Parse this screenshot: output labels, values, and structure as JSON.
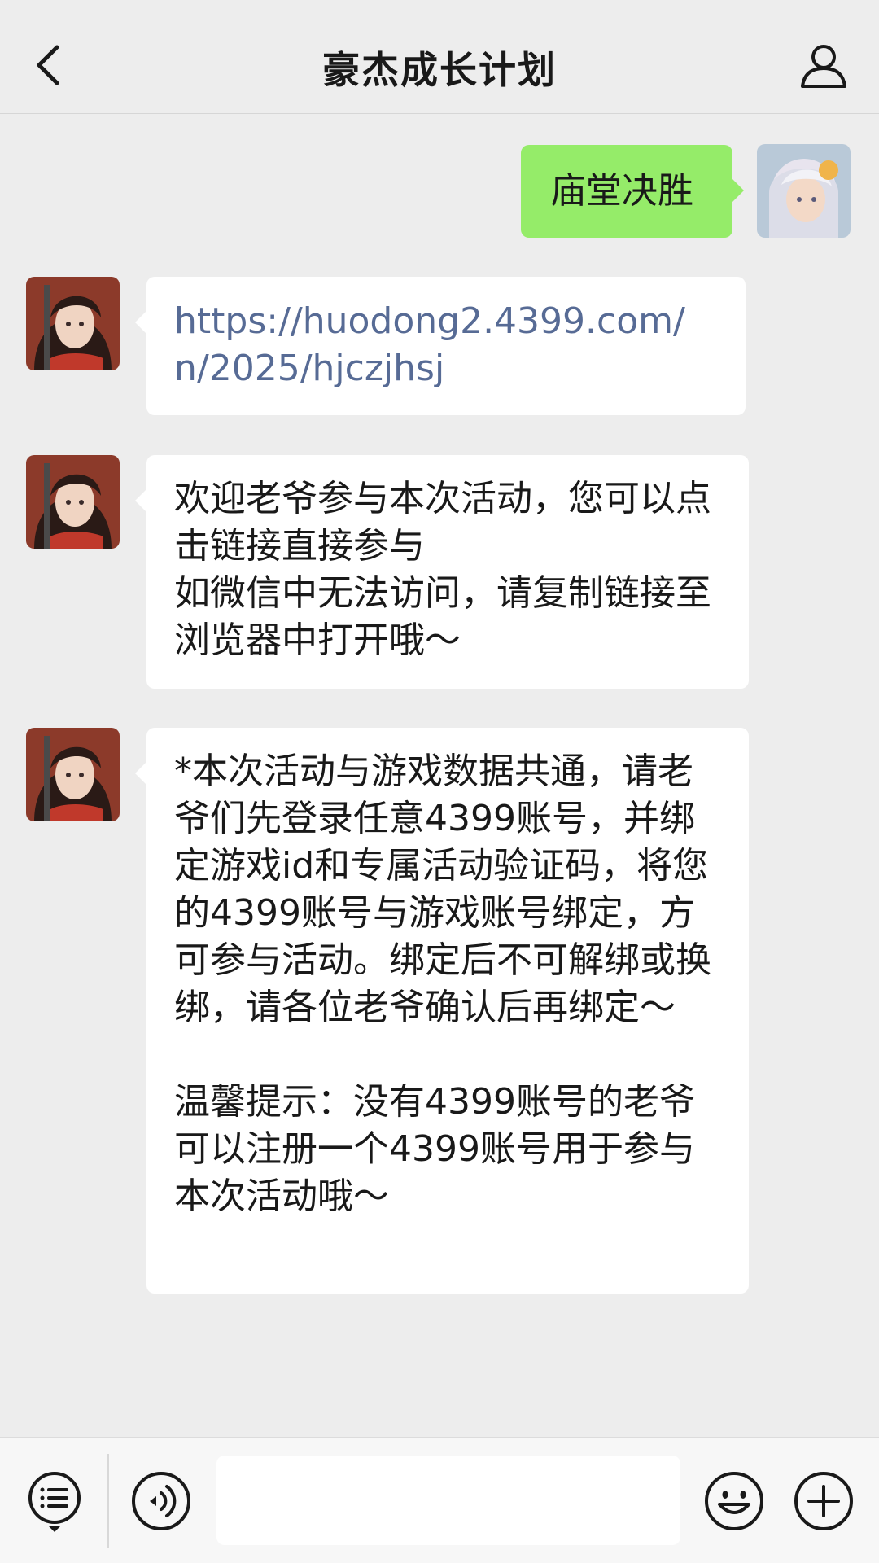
{
  "header": {
    "title": "豪杰成长计划",
    "back_icon": "chevron-left-icon",
    "profile_icon": "person-outline-icon"
  },
  "messages": [
    {
      "direction": "out",
      "text": "庙堂决胜"
    },
    {
      "direction": "in",
      "text": "https://huodong2.4399.com/n/2025/hjczjhsj",
      "is_link": true
    },
    {
      "direction": "in",
      "text": "欢迎老爷参与本次活动，您可以点击链接直接参与\n如微信中无法访问，请复制链接至浏览器中打开哦～"
    },
    {
      "direction": "in",
      "text": "*本次活动与游戏数据共通，请老爷们先登录任意4399账号，并绑定游戏id和专属活动验证码，将您的4399账号与游戏账号绑定，方可参与活动。绑定后不可解绑或换绑，请各位老爷确认后再绑定～\n\n温馨提示：没有4399账号的老爷可以注册一个4399账号用于参与本次活动哦～"
    }
  ],
  "input_bar": {
    "menu_icon": "service-menu-icon",
    "voice_icon": "voice-icon",
    "input_value": "",
    "emoji_icon": "emoji-icon",
    "plus_icon": "plus-icon"
  },
  "colors": {
    "background": "#ededed",
    "outgoing_bubble": "#95ec69",
    "incoming_bubble": "#ffffff",
    "link": "#576b95"
  }
}
